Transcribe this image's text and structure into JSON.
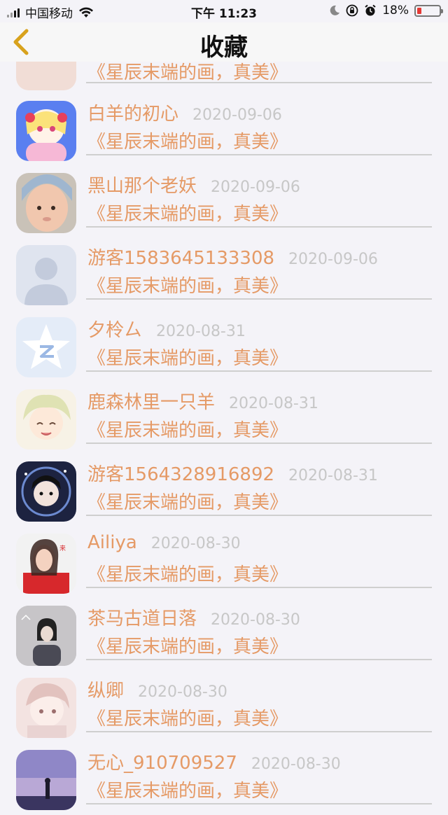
{
  "status_bar": {
    "carrier": "中国移动",
    "time": "下午 11:23",
    "battery": "18%"
  },
  "nav": {
    "title": "收藏"
  },
  "colors": {
    "accent": "#e59a66",
    "date": "#c7c7c7",
    "divider": "#cfcfcf"
  },
  "items": [
    {
      "name": "",
      "date": "",
      "message": "《星辰末端的画，真美》",
      "avatar": "partial-top"
    },
    {
      "name": "白羊的初心",
      "date": "2020-09-06",
      "message": "《星辰末端的画，真美》",
      "avatar": "anime-girl-pink"
    },
    {
      "name": "黑山那个老妖",
      "date": "2020-09-06",
      "message": "《星辰末端的画，真美》",
      "avatar": "baby-photo"
    },
    {
      "name": "游客1583645133308",
      "date": "2020-09-06",
      "message": "《星辰末端的画，真美》",
      "avatar": "default-person"
    },
    {
      "name": "夕柃ㄙ",
      "date": "2020-08-31",
      "message": "《星辰末端的画，真美》",
      "avatar": "qq-star"
    },
    {
      "name": "鹿森林里一只羊",
      "date": "2020-08-31",
      "message": "《星辰末端的画，真美》",
      "avatar": "anime-blonde"
    },
    {
      "name": "游客1564328916892",
      "date": "2020-08-31",
      "message": "《星辰末端的画，真美》",
      "avatar": "anime-dark"
    },
    {
      "name": "Ailiya",
      "date": "2020-08-30",
      "message": "《星辰末端的画，真美》",
      "avatar": "girl-red"
    },
    {
      "name": "茶马古道日落",
      "date": "2020-08-30",
      "message": "《星辰末端的画，真美》",
      "avatar": "girl-photo-grey"
    },
    {
      "name": "纵卿",
      "date": "2020-08-30",
      "message": "《星辰末端的画，真美》",
      "avatar": "anime-sketch"
    },
    {
      "name": "无心_910709527",
      "date": "2020-08-30",
      "message": "《星辰末端的画，真美》",
      "avatar": "purple-sky"
    }
  ]
}
